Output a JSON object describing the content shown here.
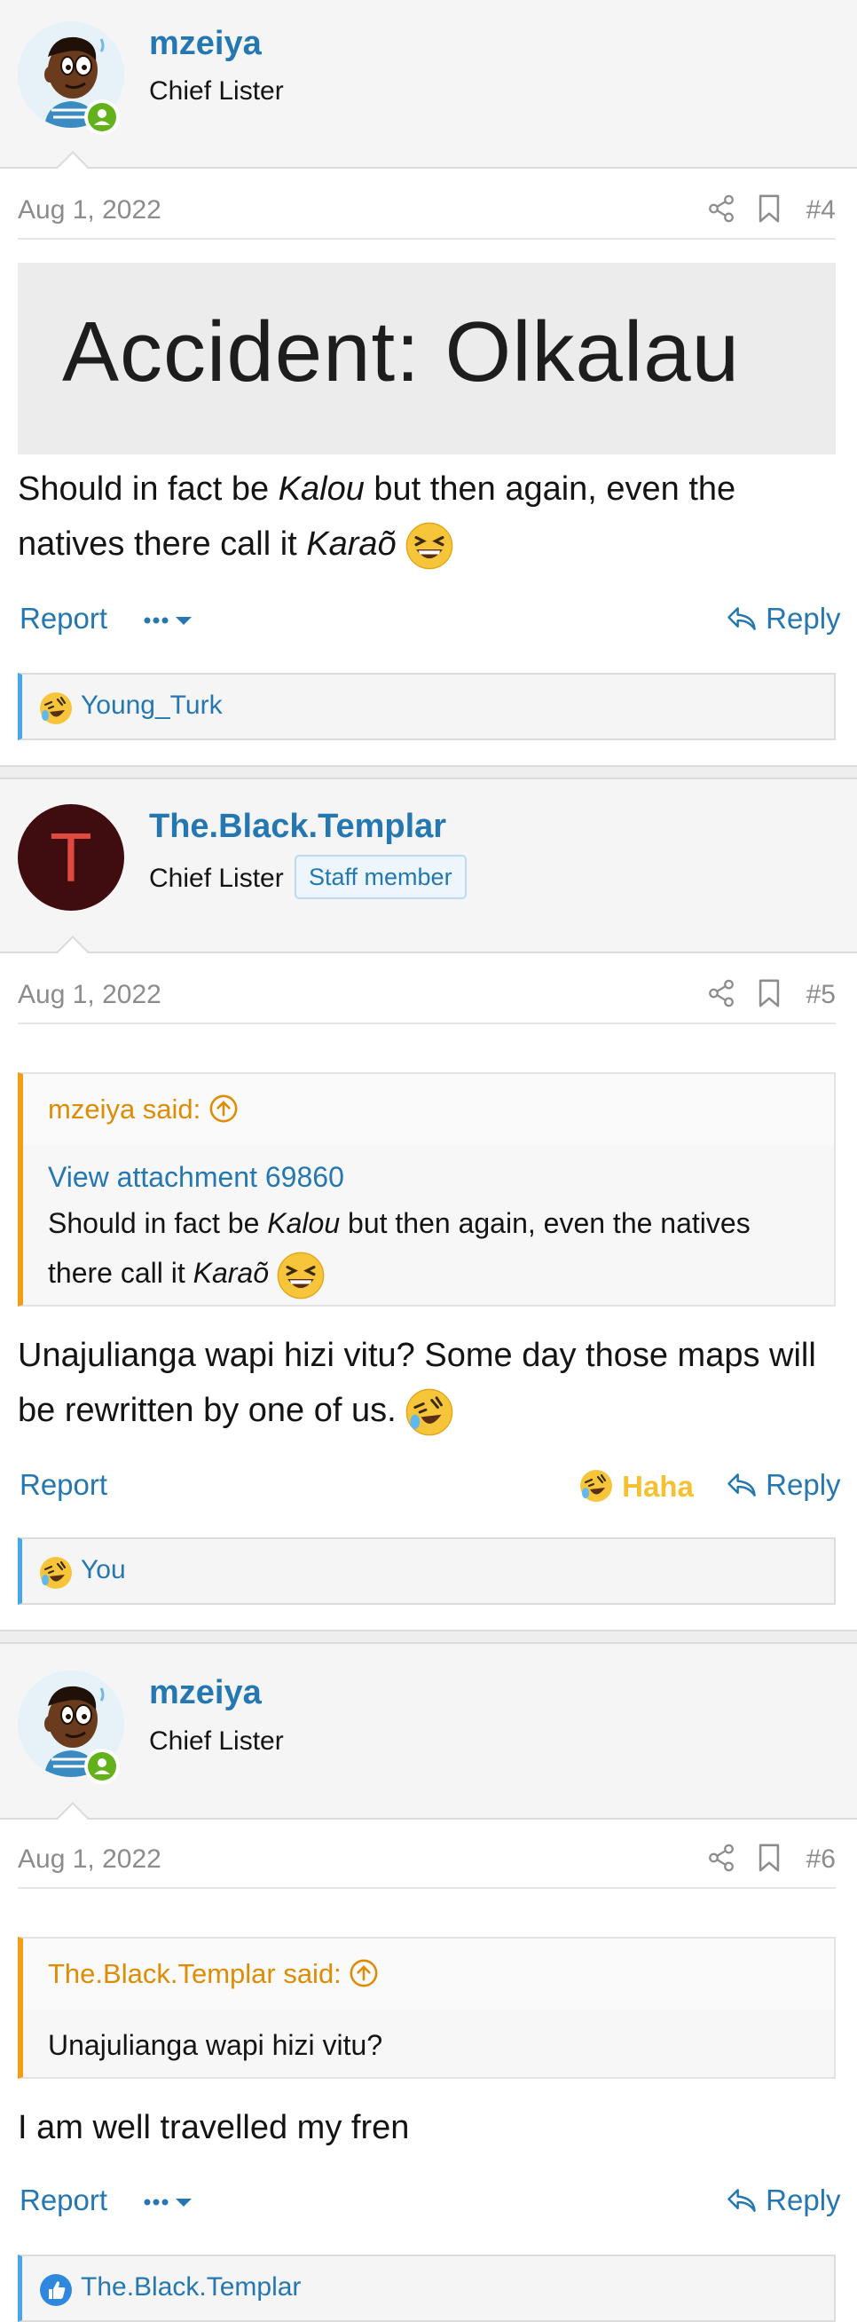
{
  "thread": {
    "posts": [
      {
        "username": "mzeiya",
        "user_title": "Chief Lister",
        "date": "Aug 1, 2022",
        "post_number": "#4",
        "attachment_text": "Accident: Olkalau",
        "body_part1": "Should in fact be ",
        "body_italic1": "Kalou",
        "body_part2": " but then again, even the natives there call it ",
        "body_italic2": "Karaõ",
        "report_label": "Report",
        "reply_label": "Reply",
        "reaction_user": "Young_Turk",
        "reaction_icon": "laughing-face-icon"
      },
      {
        "username": "The.Black.Templar",
        "avatar_letter": "T",
        "user_title": "Chief Lister",
        "staff_badge": "Staff member",
        "date": "Aug 1, 2022",
        "post_number": "#5",
        "quote_author": "mzeiya said:",
        "quote_link": "View attachment 69860",
        "quote_part1": "Should in fact be ",
        "quote_italic1": "Kalou",
        "quote_part2": " but then again, even the natives there call it ",
        "quote_italic2": "Karaõ",
        "body": "Unajulianga wapi hizi vitu? Some day those maps will be rewritten by one of us.",
        "report_label": "Report",
        "haha_label": "Haha",
        "reply_label": "Reply",
        "reaction_user": "You",
        "reaction_icon": "rofl-face-icon"
      },
      {
        "username": "mzeiya",
        "user_title": "Chief Lister",
        "date": "Aug 1, 2022",
        "post_number": "#6",
        "quote_author": "The.Black.Templar said:",
        "quote_text": "Unajulianga wapi hizi vitu?",
        "body": "I am well travelled my fren",
        "report_label": "Report",
        "reply_label": "Reply",
        "reaction_user": "The.Black.Templar",
        "reaction_icon": "like-thumb-icon"
      }
    ]
  },
  "colors": {
    "link": "#2577b1",
    "quote_accent": "#f29d16",
    "online": "#63b21b",
    "haha": "#f6c131"
  }
}
